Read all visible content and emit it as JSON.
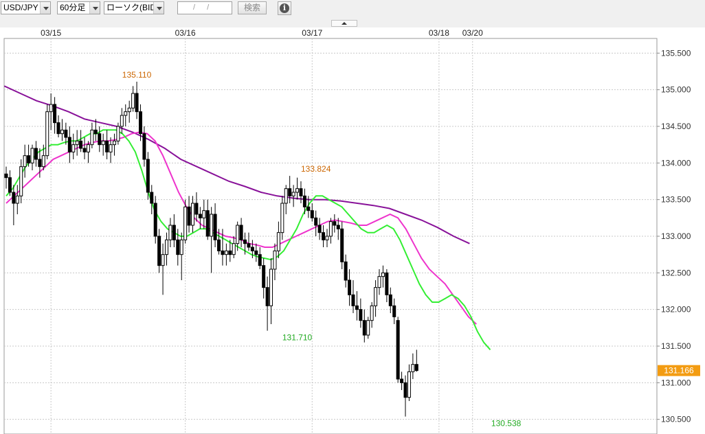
{
  "toolbar": {
    "symbol": "USD/JPY",
    "interval": "60分足",
    "price_type": "ローソク(BID)",
    "date_value": "/ /",
    "search_label": "検索",
    "info_icon": "info-icon"
  },
  "colors": {
    "ma_short": "#33ee33",
    "ma_mid": "#ee33cc",
    "ma_long": "#881199",
    "bull_fill": "#ffffff",
    "bear_fill": "#000000",
    "current_price_bg": "#f39c12",
    "high_label": "#cc6600",
    "low_label": "#22aa22"
  },
  "chart_data": {
    "type": "candlestick",
    "ylim": [
      130.3,
      135.7
    ],
    "y_ticks": [
      "135.500",
      "135.000",
      "134.500",
      "134.000",
      "133.500",
      "133.000",
      "132.500",
      "132.000",
      "131.500",
      "131.000",
      "130.500"
    ],
    "y_tick_values": [
      135.5,
      135.0,
      134.5,
      134.0,
      133.5,
      133.0,
      132.5,
      132.0,
      131.5,
      131.0,
      130.5
    ],
    "x_labels": [
      {
        "index": 12,
        "label": "03/15"
      },
      {
        "index": 48,
        "label": "03/16"
      },
      {
        "index": 82,
        "label": "03/17"
      },
      {
        "index": 116,
        "label": "03/18"
      },
      {
        "index": 125,
        "label": "03/20"
      }
    ],
    "current_price": "131.166",
    "annotations": [
      {
        "text": "135.110",
        "index": 35,
        "value": 135.11,
        "kind": "high"
      },
      {
        "text": "131.710",
        "index": 78,
        "value": 131.71,
        "kind": "low"
      },
      {
        "text": "133.824",
        "index": 83,
        "value": 133.824,
        "kind": "high"
      },
      {
        "text": "130.538",
        "index": 134,
        "value": 130.538,
        "kind": "low"
      }
    ],
    "ohlc": [
      [
        133.85,
        133.95,
        133.65,
        133.8
      ],
      [
        133.8,
        133.9,
        133.55,
        133.6
      ],
      [
        133.6,
        133.7,
        133.15,
        133.45
      ],
      [
        133.45,
        133.7,
        133.3,
        133.55
      ],
      [
        133.55,
        134.05,
        133.45,
        133.95
      ],
      [
        133.95,
        134.25,
        133.8,
        134.1
      ],
      [
        134.1,
        134.25,
        133.95,
        134.0
      ],
      [
        134.0,
        134.25,
        133.9,
        134.2
      ],
      [
        134.2,
        134.3,
        133.95,
        134.05
      ],
      [
        134.05,
        134.2,
        133.8,
        133.95
      ],
      [
        133.95,
        134.25,
        133.9,
        134.1
      ],
      [
        134.1,
        134.8,
        134.05,
        134.7
      ],
      [
        134.7,
        134.95,
        134.45,
        134.8
      ],
      [
        134.8,
        134.9,
        134.4,
        134.55
      ],
      [
        134.55,
        134.65,
        134.35,
        134.4
      ],
      [
        134.4,
        134.6,
        134.3,
        134.45
      ],
      [
        134.45,
        134.55,
        134.25,
        134.35
      ],
      [
        134.35,
        134.5,
        134.0,
        134.15
      ],
      [
        134.15,
        134.4,
        134.05,
        134.25
      ],
      [
        134.25,
        134.45,
        134.1,
        134.3
      ],
      [
        134.3,
        134.45,
        134.15,
        134.2
      ],
      [
        134.2,
        134.35,
        134.05,
        134.15
      ],
      [
        134.15,
        134.3,
        134.0,
        134.25
      ],
      [
        134.25,
        134.55,
        134.2,
        134.45
      ],
      [
        134.45,
        134.6,
        134.3,
        134.4
      ],
      [
        134.4,
        134.5,
        134.15,
        134.25
      ],
      [
        134.25,
        134.4,
        134.1,
        134.3
      ],
      [
        134.3,
        134.45,
        134.05,
        134.15
      ],
      [
        134.15,
        134.35,
        134.0,
        134.25
      ],
      [
        134.25,
        134.4,
        134.1,
        134.3
      ],
      [
        134.3,
        134.55,
        134.25,
        134.5
      ],
      [
        134.5,
        134.75,
        134.4,
        134.65
      ],
      [
        134.65,
        134.8,
        134.5,
        134.7
      ],
      [
        134.7,
        134.85,
        134.55,
        134.75
      ],
      [
        134.75,
        135.05,
        134.7,
        134.95
      ],
      [
        134.95,
        135.11,
        134.6,
        134.7
      ],
      [
        134.7,
        134.8,
        134.3,
        134.4
      ],
      [
        134.4,
        134.5,
        133.95,
        134.05
      ],
      [
        134.05,
        134.15,
        133.5,
        133.6
      ],
      [
        133.6,
        133.7,
        133.3,
        133.45
      ],
      [
        133.45,
        133.55,
        132.9,
        133.0
      ],
      [
        133.0,
        133.1,
        132.5,
        132.6
      ],
      [
        132.6,
        132.9,
        132.2,
        132.75
      ],
      [
        132.75,
        133.05,
        132.6,
        132.95
      ],
      [
        132.95,
        133.25,
        132.85,
        133.15
      ],
      [
        133.15,
        133.3,
        132.85,
        132.95
      ],
      [
        132.95,
        133.1,
        132.6,
        132.75
      ],
      [
        132.75,
        133.05,
        132.4,
        132.95
      ],
      [
        132.95,
        133.5,
        132.9,
        133.4
      ],
      [
        133.4,
        133.55,
        133.05,
        133.15
      ],
      [
        133.15,
        133.55,
        133.05,
        133.45
      ],
      [
        133.45,
        133.6,
        133.2,
        133.3
      ],
      [
        133.3,
        133.4,
        133.1,
        133.25
      ],
      [
        133.25,
        133.5,
        133.1,
        133.35
      ],
      [
        133.35,
        133.5,
        132.95,
        133.0
      ],
      [
        133.0,
        133.4,
        132.5,
        133.3
      ],
      [
        133.3,
        133.45,
        132.85,
        132.95
      ],
      [
        132.95,
        133.1,
        132.75,
        132.8
      ],
      [
        132.8,
        133.1,
        132.6,
        132.75
      ],
      [
        132.75,
        132.9,
        132.6,
        132.8
      ],
      [
        132.8,
        132.95,
        132.65,
        132.75
      ],
      [
        132.75,
        133.0,
        132.7,
        132.9
      ],
      [
        132.9,
        133.2,
        132.8,
        133.15
      ],
      [
        133.15,
        133.25,
        132.85,
        132.95
      ],
      [
        132.95,
        133.05,
        132.75,
        132.9
      ],
      [
        132.9,
        133.05,
        132.8,
        132.85
      ],
      [
        132.85,
        132.95,
        132.7,
        132.8
      ],
      [
        132.8,
        132.9,
        132.65,
        132.75
      ],
      [
        132.75,
        132.85,
        132.55,
        132.6
      ],
      [
        132.6,
        132.7,
        132.15,
        132.3
      ],
      [
        132.3,
        132.45,
        131.71,
        132.05
      ],
      [
        132.05,
        132.7,
        131.8,
        132.55
      ],
      [
        132.55,
        132.9,
        132.4,
        132.8
      ],
      [
        132.8,
        133.2,
        132.7,
        133.05
      ],
      [
        133.05,
        133.55,
        132.95,
        133.45
      ],
      [
        133.45,
        133.7,
        133.3,
        133.65
      ],
      [
        133.65,
        133.824,
        133.45,
        133.55
      ],
      [
        133.55,
        133.7,
        133.4,
        133.6
      ],
      [
        133.6,
        133.8,
        133.5,
        133.65
      ],
      [
        133.65,
        133.75,
        133.45,
        133.55
      ],
      [
        133.55,
        133.65,
        133.3,
        133.4
      ],
      [
        133.4,
        133.55,
        133.25,
        133.35
      ],
      [
        133.35,
        133.45,
        133.2,
        133.25
      ],
      [
        133.25,
        133.35,
        133.0,
        133.15
      ],
      [
        133.15,
        133.25,
        132.95,
        133.05
      ],
      [
        133.05,
        133.15,
        132.85,
        132.95
      ],
      [
        132.95,
        133.1,
        132.85,
        133.0
      ],
      [
        133.0,
        133.25,
        132.9,
        133.2
      ],
      [
        133.2,
        133.3,
        133.05,
        133.15
      ],
      [
        133.15,
        133.25,
        132.95,
        133.1
      ],
      [
        133.1,
        133.2,
        132.55,
        132.65
      ],
      [
        132.65,
        132.75,
        132.3,
        132.4
      ],
      [
        132.4,
        132.55,
        132.05,
        132.2
      ],
      [
        132.2,
        132.4,
        131.95,
        132.05
      ],
      [
        132.05,
        132.25,
        131.85,
        132.0
      ],
      [
        132.0,
        132.15,
        131.75,
        131.85
      ],
      [
        131.85,
        132.0,
        131.55,
        131.65
      ],
      [
        131.65,
        131.9,
        131.6,
        131.85
      ],
      [
        131.85,
        132.1,
        131.75,
        132.05
      ],
      [
        132.05,
        132.4,
        131.9,
        132.3
      ],
      [
        132.3,
        132.55,
        132.2,
        132.45
      ],
      [
        132.45,
        132.6,
        132.3,
        132.5
      ],
      [
        132.5,
        132.55,
        132.1,
        132.2
      ],
      [
        132.2,
        132.3,
        131.95,
        132.05
      ],
      [
        132.05,
        132.15,
        131.8,
        131.9
      ],
      [
        131.85,
        131.9,
        131.0,
        131.05
      ],
      [
        131.05,
        131.15,
        130.9,
        131.0
      ],
      [
        131.0,
        131.1,
        130.538,
        130.8
      ],
      [
        130.8,
        131.25,
        130.75,
        131.15
      ],
      [
        131.15,
        131.4,
        131.05,
        131.25
      ],
      [
        131.25,
        131.45,
        131.15,
        131.166
      ]
    ],
    "ma_short": [
      133.55,
      133.65,
      133.8,
      133.95,
      134.05,
      134.15,
      134.2,
      134.25,
      134.25,
      134.28,
      134.3,
      134.3,
      134.35,
      134.4,
      134.4,
      134.45,
      134.45,
      134.45,
      134.4,
      134.3,
      134.15,
      133.9,
      133.6,
      133.35,
      133.2,
      133.1,
      133.05,
      133.0,
      133.0,
      133.05,
      133.1,
      133.1,
      133.05,
      133.0,
      132.95,
      132.9,
      132.85,
      132.8,
      132.75,
      132.72,
      132.7,
      132.68,
      132.72,
      132.8,
      132.95,
      133.1,
      133.3,
      133.45,
      133.55,
      133.55,
      133.5,
      133.45,
      133.4,
      133.3,
      133.2,
      133.1,
      133.05,
      133.05,
      133.1,
      133.15,
      133.1,
      132.95,
      132.75,
      132.55,
      132.35,
      132.2,
      132.1,
      132.1,
      132.15,
      132.2,
      132.15,
      132.05,
      131.9,
      131.7,
      131.55,
      131.45
    ],
    "ma_mid": [
      133.45,
      133.55,
      133.65,
      133.75,
      133.85,
      133.95,
      134.05,
      134.1,
      134.15,
      134.2,
      134.25,
      134.28,
      134.3,
      134.3,
      134.32,
      134.35,
      134.4,
      134.42,
      134.4,
      134.3,
      134.1,
      133.85,
      133.6,
      133.4,
      133.25,
      133.15,
      133.1,
      133.05,
      133.0,
      132.98,
      132.95,
      132.9,
      132.88,
      132.85,
      132.85,
      132.9,
      132.95,
      133.0,
      133.05,
      133.1,
      133.15,
      133.2,
      133.22,
      133.2,
      133.18,
      133.15,
      133.15,
      133.2,
      133.25,
      133.3,
      133.25,
      133.1,
      132.9,
      132.7,
      132.55,
      132.45,
      132.35,
      132.2,
      132.05,
      131.9,
      131.8
    ],
    "ma_long": [
      135.05,
      134.95,
      134.85,
      134.78,
      134.7,
      134.6,
      134.55,
      134.5,
      134.42,
      134.32,
      134.2,
      134.05,
      133.95,
      133.85,
      133.75,
      133.68,
      133.6,
      133.55,
      133.52,
      133.5,
      133.5,
      133.48,
      133.45,
      133.42,
      133.38,
      133.3,
      133.22,
      133.12,
      133.0,
      132.9
    ]
  }
}
